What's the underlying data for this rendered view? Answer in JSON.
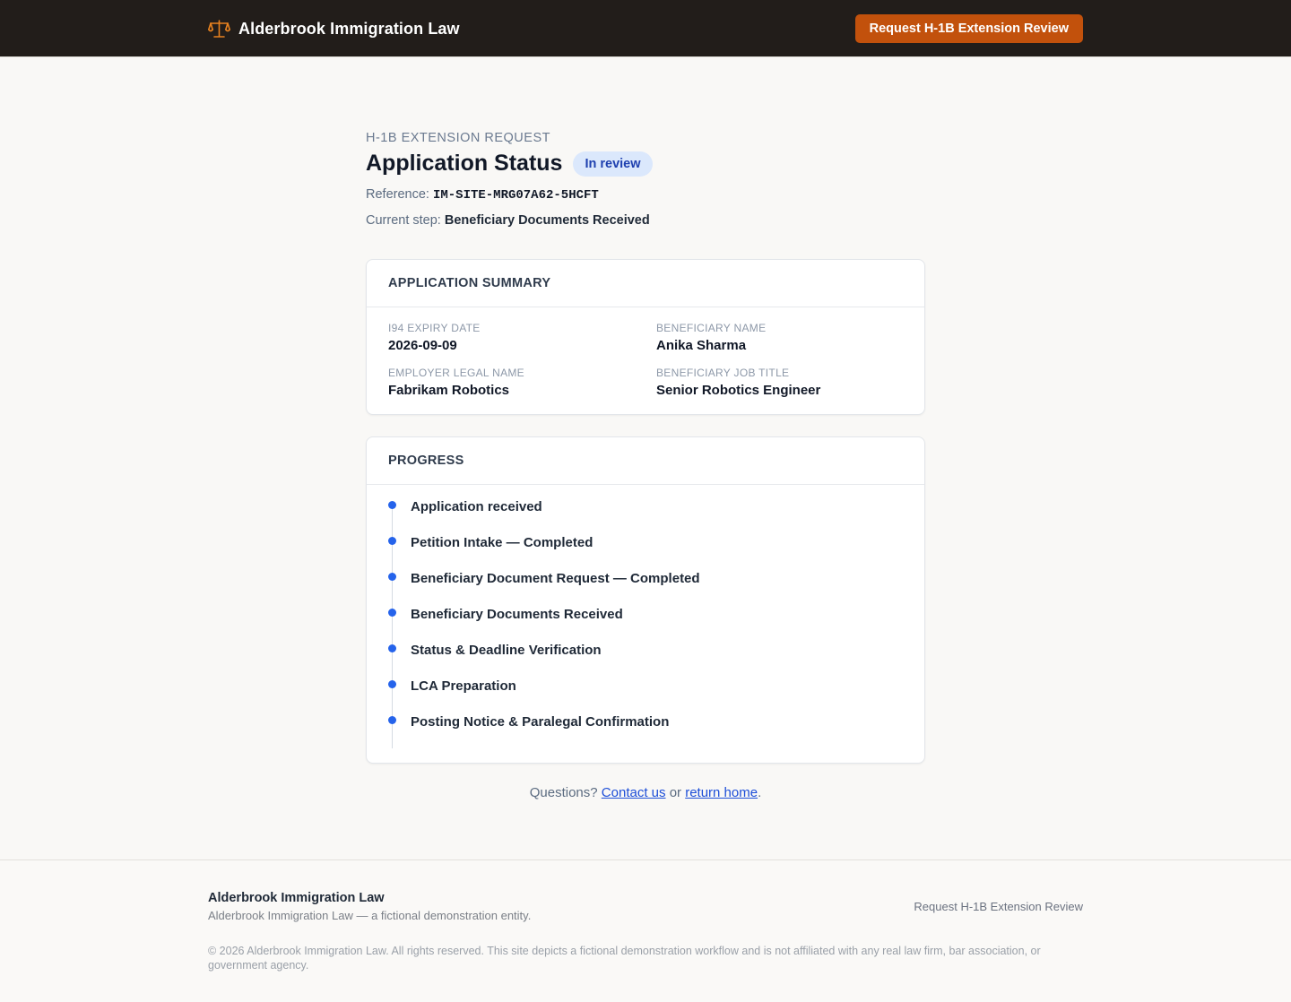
{
  "header": {
    "brand": "Alderbrook Immigration Law",
    "cta_label": "Request H-1B Extension Review",
    "brand_icon": "scales-icon",
    "accent": "#c2510c"
  },
  "status": {
    "eyebrow": "H-1B EXTENSION REQUEST",
    "title": "Application Status",
    "badge": "In review",
    "reference_label": "Reference:",
    "reference": "IM-SITE-MRG07A62-5HCFT",
    "step_label": "Current step:",
    "current_step": "Beneficiary Documents Received"
  },
  "summary": {
    "heading": "APPLICATION SUMMARY",
    "fields": [
      {
        "label": "I94 EXPIRY DATE",
        "value": "2026-09-09"
      },
      {
        "label": "BENEFICIARY NAME",
        "value": "Anika Sharma"
      },
      {
        "label": "EMPLOYER LEGAL NAME",
        "value": "Fabrikam Robotics"
      },
      {
        "label": "BENEFICIARY JOB TITLE",
        "value": "Senior Robotics Engineer"
      }
    ]
  },
  "progress": {
    "heading": "PROGRESS",
    "dot_color": "#2563eb",
    "steps": [
      "Application received",
      "Petition Intake — Completed",
      "Beneficiary Document Request — Completed",
      "Beneficiary Documents Received",
      "Status & Deadline Verification",
      "LCA Preparation",
      "Posting Notice & Paralegal Confirmation"
    ]
  },
  "questions": {
    "prefix": "Questions?",
    "contact": "Contact us",
    "middle": "or",
    "home": "return home",
    "suffix": "."
  },
  "footer": {
    "name": "Alderbrook Immigration Law",
    "tagline": "Alderbrook Immigration Law — a fictional demonstration entity.",
    "link": "Request H-1B Extension Review",
    "legal": "© 2026 Alderbrook Immigration Law. All rights reserved. This site depicts a fictional demonstration workflow and is not affiliated with any real law firm, bar association, or government agency."
  }
}
